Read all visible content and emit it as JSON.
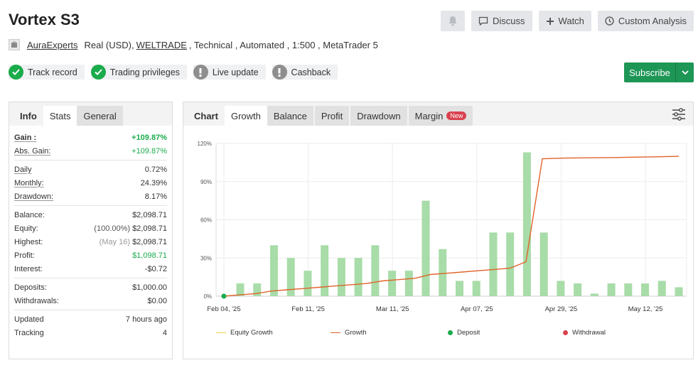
{
  "title": "Vortex S3",
  "top_actions": {
    "discuss": "Discuss",
    "watch": "Watch",
    "custom_analysis": "Custom Analysis"
  },
  "subline": {
    "author": "AuraExperts",
    "account": "Real (USD),",
    "broker": "WELTRADE",
    "details": ", Technical , Automated , 1:500 , MetaTrader 5"
  },
  "badges": [
    {
      "label": "Track record",
      "status": "ok"
    },
    {
      "label": "Trading privileges",
      "status": "ok"
    },
    {
      "label": "Live update",
      "status": "warn"
    },
    {
      "label": "Cashback",
      "status": "warn"
    }
  ],
  "subscribe_label": "Subscribe",
  "stats_tabs": [
    "Info",
    "Stats",
    "General"
  ],
  "stats": {
    "gain_label": "Gain :",
    "gain_value": "+109.87%",
    "abs_gain_label": "Abs. Gain:",
    "abs_gain_value": "+109.87%",
    "daily_label": "Daily",
    "daily_value": "0.72%",
    "monthly_label": "Monthly:",
    "monthly_value": "24.39%",
    "drawdown_label": "Drawdown:",
    "drawdown_value": "8.17%",
    "balance_label": "Balance:",
    "balance_value": "$2,098.71",
    "equity_label": "Equity:",
    "equity_pct": "(100.00%)",
    "equity_value": "$2,098.71",
    "highest_label": "Highest:",
    "highest_date": "(May 16)",
    "highest_value": "$2,098.71",
    "profit_label": "Profit:",
    "profit_value": "$1,098.71",
    "interest_label": "Interest:",
    "interest_value": "-$0.72",
    "deposits_label": "Deposits:",
    "deposits_value": "$1,000.00",
    "withdrawals_label": "Withdrawals:",
    "withdrawals_value": "$0.00",
    "updated_label": "Updated",
    "updated_value": "7 hours ago",
    "tracking_label": "Tracking",
    "tracking_value": "4"
  },
  "chart_tabs": {
    "chart": "Chart",
    "growth": "Growth",
    "balance": "Balance",
    "profit": "Profit",
    "drawdown": "Drawdown",
    "margin": "Margin",
    "new_badge": "New"
  },
  "legend": {
    "equity_growth": "Equity Growth",
    "growth": "Growth",
    "deposit": "Deposit",
    "withdrawal": "Withdrawal"
  },
  "colors": {
    "green": "#1aab4b",
    "bar": "#a8dca8",
    "growth_line": "#e0632a",
    "equity_line": "#e8d44a",
    "deposit": "#1aab4b",
    "withdrawal": "#d9414e"
  },
  "chart_data": {
    "type": "bar",
    "ylim": [
      0,
      120
    ],
    "yticks": [
      0,
      30,
      60,
      90,
      120
    ],
    "ytick_labels": [
      "0%",
      "30%",
      "60%",
      "90%",
      "120%"
    ],
    "xtick_labels": [
      "Feb 04, '25",
      "Feb 11, '25",
      "Mar 11, '25",
      "Apr 07, '25",
      "Apr 29, '25",
      "May 12, '25"
    ],
    "bars": [
      10,
      10,
      40,
      30,
      20,
      40,
      30,
      30,
      40,
      20,
      20,
      75,
      37,
      12,
      12,
      50,
      50,
      113,
      50,
      12,
      10,
      2,
      10,
      10,
      10,
      12,
      7
    ],
    "growth_line": [
      0,
      1,
      2,
      4,
      5,
      6,
      7,
      8,
      9,
      10,
      12,
      13,
      14,
      17,
      18,
      19,
      20,
      21,
      22,
      27,
      108,
      108.5,
      108.7,
      108.9,
      109.2,
      109.5,
      109.87
    ],
    "deposit_value": 0
  }
}
